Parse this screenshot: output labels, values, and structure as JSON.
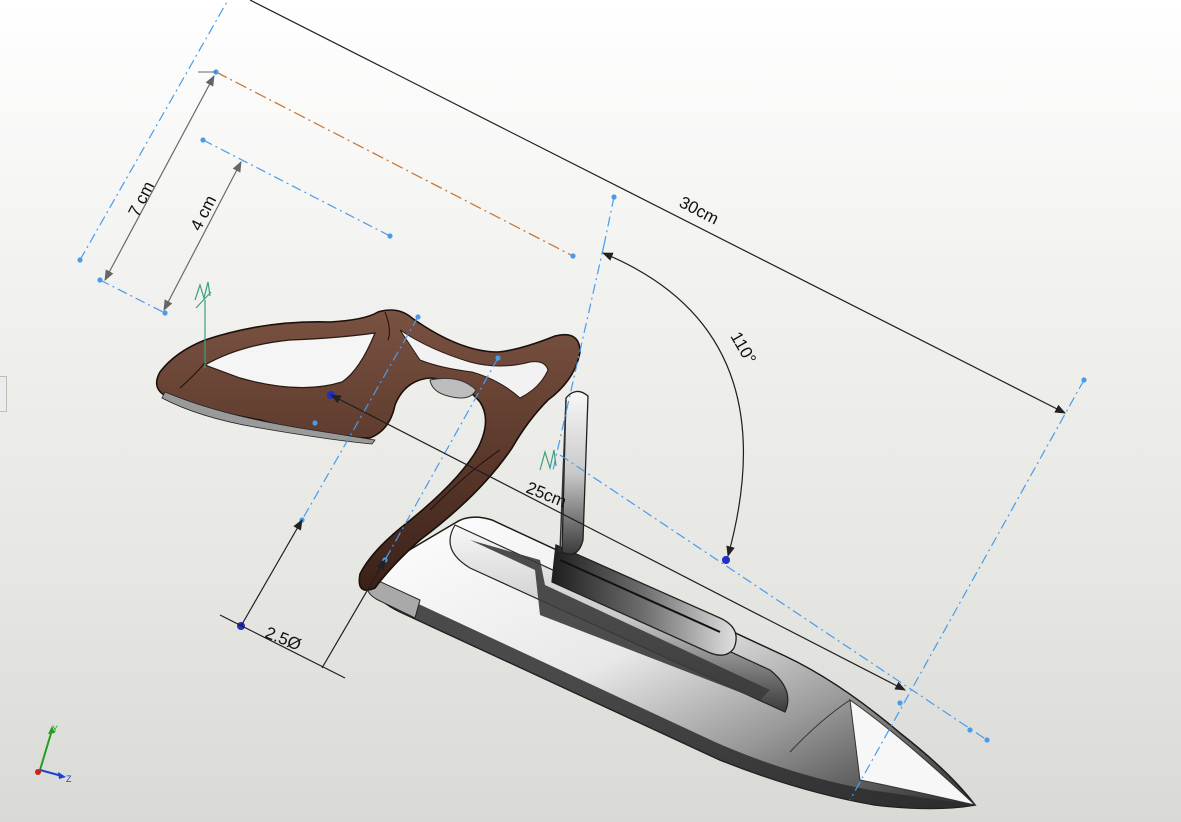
{
  "dimensions": {
    "overall_length": "30cm",
    "blade_angle": "110°",
    "handle_span": "25cm",
    "ring_diameter": "2.5Ø",
    "outer_offset": "7 cm",
    "inner_offset": "4 cm"
  },
  "triad": {
    "y_label": "Y",
    "z_label": "Z"
  },
  "colors": {
    "handle": "#5c3a2c",
    "construction_line": "#4a9bea",
    "orange_centerline": "#c9793a",
    "dimension_line": "#222222",
    "axis_x": "#d02020",
    "axis_y": "#20a020",
    "axis_z": "#2040d0"
  },
  "icons": [
    "view-triad-icon",
    "side-panel-tab-icon"
  ]
}
